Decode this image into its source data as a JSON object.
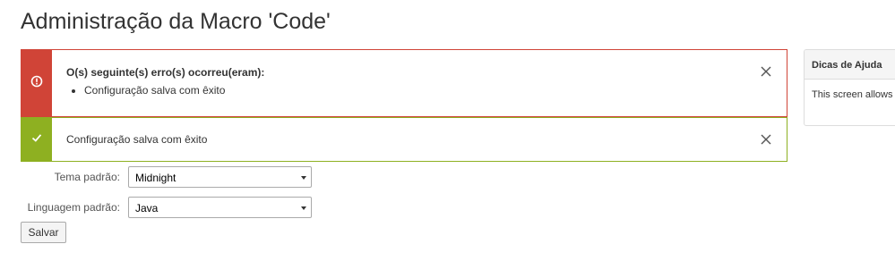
{
  "page": {
    "title": "Administração da Macro 'Code'"
  },
  "alerts": {
    "error": {
      "heading": "O(s) seguinte(s) erro(s) ocorreu(eram):",
      "items": [
        "Configuração salva com êxito"
      ],
      "color": "#d04437",
      "icon": "error-exclamation-icon"
    },
    "success": {
      "message": "Configuração salva com êxito",
      "color": "#8eb021",
      "icon": "checkmark-icon"
    },
    "close_icon": "close-icon"
  },
  "help": {
    "heading": "Dicas de Ajuda",
    "body": "This screen allows of the code block"
  },
  "form": {
    "theme": {
      "label": "Tema padrão:",
      "value": "Midnight"
    },
    "language": {
      "label": "Linguagem padrão:",
      "value": "Java"
    },
    "save_label": "Salvar"
  }
}
